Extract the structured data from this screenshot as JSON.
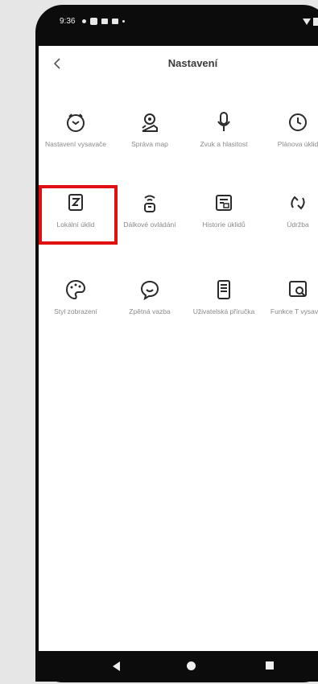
{
  "status_bar": {
    "time": "9:36"
  },
  "header": {
    "title": "Nastavení",
    "back_icon": "chevron-left-icon"
  },
  "grid": [
    {
      "label": "Nastavení vysavače",
      "icon": "robot-vacuum-icon"
    },
    {
      "label": "Správa map",
      "icon": "map-pin-icon"
    },
    {
      "label": "Zvuk a hlasitost",
      "icon": "microphone-icon"
    },
    {
      "label": "Plánova úklid",
      "icon": "clock-icon"
    },
    {
      "label": "Lokální úklid",
      "icon": "local-clean-icon"
    },
    {
      "label": "Dálkové ovládání",
      "icon": "remote-control-icon"
    },
    {
      "label": "Historie úklidů",
      "icon": "history-icon"
    },
    {
      "label": "Údržba",
      "icon": "maintenance-icon"
    },
    {
      "label": "Styl zobrazení",
      "icon": "palette-icon"
    },
    {
      "label": "Zpětná vazba",
      "icon": "feedback-icon"
    },
    {
      "label": "Uživatelská příručka",
      "icon": "manual-icon"
    },
    {
      "label": "Funkce T vysavač",
      "icon": "function-icon"
    }
  ],
  "colors": {
    "icon_stroke": "#2a2a2a",
    "label_text": "#8a8a8a",
    "highlight": "#e01010"
  }
}
